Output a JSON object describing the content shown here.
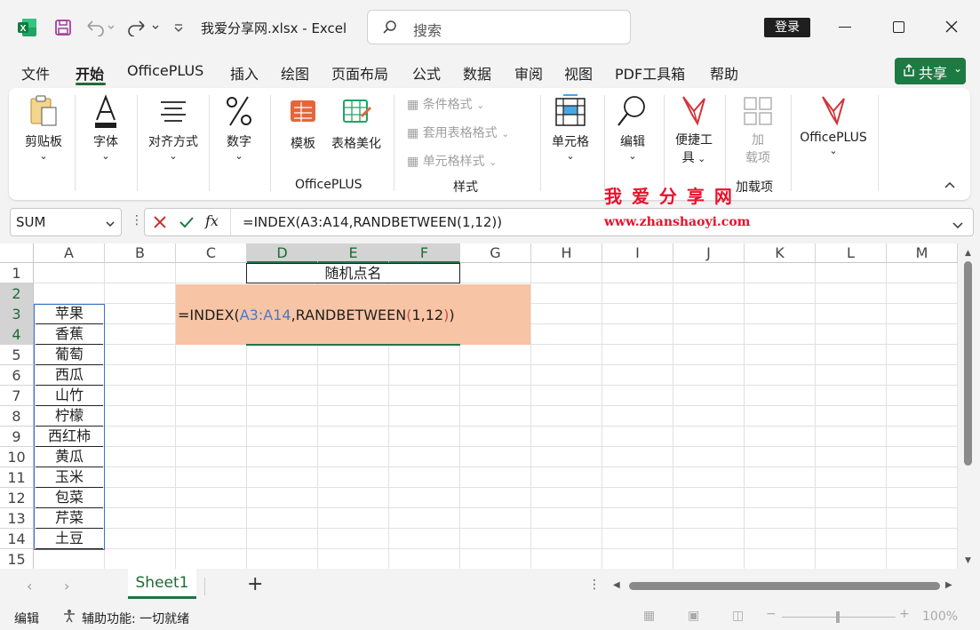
{
  "titlebar": {
    "title": "我爱分享网.xlsx  -  Excel",
    "search_placeholder": "搜索",
    "login_label": "登录"
  },
  "menu": {
    "tabs": [
      "文件",
      "开始",
      "OfficePLUS",
      "插入",
      "绘图",
      "页面布局",
      "公式",
      "数据",
      "审阅",
      "视图",
      "PDF工具箱",
      "帮助"
    ],
    "active": "开始",
    "share_label": "共享"
  },
  "ribbon": {
    "clipboard": "剪贴板",
    "font": "字体",
    "align": "对齐方式",
    "number": "数字",
    "template": "模板",
    "beautify": "表格美化",
    "officeplus_group": "OfficePLUS",
    "cond_format": "条件格式",
    "table_format": "套用表格格式",
    "cell_style": "单元格样式",
    "style_group": "样式",
    "cells": "单元格",
    "edit": "编辑",
    "quick_tool_1": "便捷工",
    "quick_tool_2": "具",
    "addin_1": "加",
    "addin_2": "载项",
    "addin_group": "加载项",
    "officeplus_btn": "OfficePLUS"
  },
  "watermark": {
    "title": "我 爱 分 享 网",
    "url": "www.zhanshaoyi.com"
  },
  "formula_bar": {
    "name_box": "SUM",
    "formula": "=INDEX(A3:A14,RANDBETWEEN(1,12))"
  },
  "grid": {
    "columns": [
      "A",
      "B",
      "C",
      "D",
      "E",
      "F",
      "G",
      "H",
      "I",
      "J",
      "K",
      "L",
      "M"
    ],
    "rows": [
      "1",
      "2",
      "3",
      "4",
      "5",
      "6",
      "7",
      "8",
      "9",
      "10",
      "11",
      "12",
      "13",
      "14",
      "15"
    ],
    "header_cell": "随机点名",
    "editing": {
      "prefix": "=INDEX(",
      "ref": "A3:A14",
      "mid": ",RANDBETWEEN",
      "open": "(",
      "args": "1,12",
      "close": ")",
      "end": ")"
    },
    "values": [
      "苹果",
      "香蕉",
      "葡萄",
      "西瓜",
      "山竹",
      "柠檬",
      "西红柿",
      "黄瓜",
      "玉米",
      "包菜",
      "芹菜",
      "土豆"
    ],
    "colors": {
      "edit_bg": "#f7c4a5",
      "ref_blue": "#4a78c2",
      "paren_red": "#c0504d",
      "accent": "#217346"
    }
  },
  "sheets": {
    "tabs": [
      "Sheet1"
    ]
  },
  "status": {
    "mode": "编辑",
    "accessibility": "辅助功能: 一切就绪",
    "zoom": "100%"
  }
}
